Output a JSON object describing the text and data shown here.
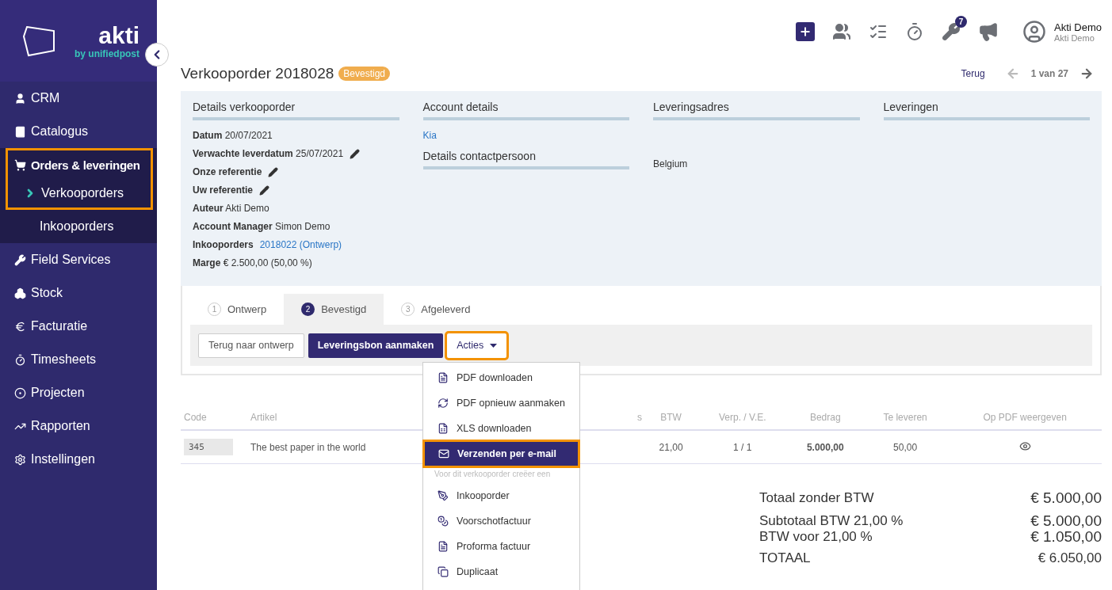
{
  "sidebar": {
    "logo": {
      "name": "akti",
      "tagline": "by unifiedpost"
    },
    "items": [
      {
        "label": "CRM",
        "selected": false,
        "highlighted": false
      },
      {
        "label": "Catalogus",
        "selected": false,
        "highlighted": false
      },
      {
        "label": "Orders & leveringen",
        "selected": true,
        "highlighted": true,
        "expanded": true,
        "children": [
          {
            "label": "Verkooporders",
            "selected": true
          },
          {
            "label": "Inkooporders",
            "selected": false
          }
        ]
      },
      {
        "label": "Field Services",
        "selected": false,
        "highlighted": false
      },
      {
        "label": "Stock",
        "selected": false,
        "highlighted": false
      },
      {
        "label": "Facturatie",
        "selected": false,
        "highlighted": false
      },
      {
        "label": "Timesheets",
        "selected": false,
        "highlighted": false
      },
      {
        "label": "Projecten",
        "selected": false,
        "highlighted": false
      },
      {
        "label": "Rapporten",
        "selected": false,
        "highlighted": false
      },
      {
        "label": "Instellingen",
        "selected": false,
        "highlighted": false
      }
    ]
  },
  "topbar": {
    "notification_count": "7",
    "user": {
      "name": "Akti Demo",
      "subtitle": "Akti Demo"
    }
  },
  "pager": {
    "back": "Terug",
    "position": "1 van 27",
    "prev_disabled": true
  },
  "title": "Verkooporder 2018028",
  "status": "Bevestigd",
  "details": {
    "title": "Details verkooporder",
    "fields": [
      {
        "label": "Datum",
        "value": "20/07/2021",
        "editable": false,
        "kind": "text"
      },
      {
        "label": "Verwachte leverdatum",
        "value": "25/07/2021",
        "editable": true,
        "kind": "text"
      },
      {
        "label": "Onze referentie",
        "editable": true,
        "kind": "text"
      },
      {
        "label": "Uw referentie",
        "editable": true,
        "kind": "text"
      },
      {
        "label": "Auteur",
        "value": "Akti Demo",
        "editable": false,
        "kind": "text"
      },
      {
        "label": "Account Manager",
        "value": "Simon Demo",
        "editable": false,
        "kind": "text"
      },
      {
        "label": "Inkooporders",
        "value": "2018022 (Ontwerp)",
        "editable": false,
        "kind": "link"
      },
      {
        "label": "Marge",
        "value": "€ 2.500,00 (50,00 %)",
        "editable": false,
        "kind": "text"
      }
    ]
  },
  "account": {
    "title": "Account details",
    "name": "Kia",
    "contact_title": "Details contactpersoon"
  },
  "delivery_address": {
    "title": "Leveringsadres",
    "country": "Belgium"
  },
  "deliveries": {
    "title": "Leveringen"
  },
  "steps": [
    {
      "number": "1",
      "label": "Ontwerp",
      "selected": false
    },
    {
      "number": "2",
      "label": "Bevestigd",
      "selected": true
    },
    {
      "number": "3",
      "label": "Afgeleverd",
      "selected": false
    }
  ],
  "actions": [
    {
      "label": "Terug naar ontwerp",
      "kind": "secondary",
      "highlighted": false
    },
    {
      "label": "Leveringsbon aanmaken",
      "kind": "primary",
      "highlighted": false
    },
    {
      "label": "Acties",
      "kind": "dropdown",
      "highlighted": true
    }
  ],
  "menu": [
    {
      "kind": "item",
      "label": "PDF downloaden",
      "selected": false,
      "highlighted": false
    },
    {
      "kind": "item",
      "label": "PDF opnieuw aanmaken",
      "selected": false,
      "highlighted": false
    },
    {
      "kind": "item",
      "label": "XLS downloaden",
      "selected": false,
      "highlighted": false
    },
    {
      "kind": "item",
      "label": "Verzenden per e-mail",
      "selected": true,
      "highlighted": true
    },
    {
      "kind": "header",
      "label": "Voor dit verkooporder creëer een"
    },
    {
      "kind": "item",
      "label": "Inkooporder",
      "selected": false,
      "highlighted": false
    },
    {
      "kind": "item",
      "label": "Voorschotfactuur",
      "selected": false,
      "highlighted": false
    },
    {
      "kind": "item",
      "label": "Proforma factuur",
      "selected": false,
      "highlighted": false
    },
    {
      "kind": "item",
      "label": "Duplicaat",
      "selected": false,
      "highlighted": false
    }
  ],
  "table": {
    "columns": [
      "Code",
      "Artikel",
      "s",
      "BTW",
      "Verp. / V.E.",
      "Bedrag",
      "Te leveren",
      "Op PDF weergeven"
    ],
    "rows": [
      {
        "code": "345",
        "article": "The best paper in the world",
        "btw": "21,00",
        "packaging": "1 / 1",
        "amount": "5.000,00",
        "to_deliver": "50,00",
        "show_on_pdf": true
      }
    ]
  },
  "totals": [
    {
      "label": "Totaal zonder BTW",
      "value": "€ 5.000,00",
      "kind": "main"
    },
    {
      "label": "Subtotaal  BTW 21,00 %",
      "value": "€ 5.000,00",
      "kind": "tight"
    },
    {
      "label": "BTW voor 21,00 %",
      "value": "€ 1.050,00",
      "kind": "tight"
    },
    {
      "label": "TOTAAL",
      "value": "€ 6.050,00",
      "kind": "total"
    }
  ]
}
